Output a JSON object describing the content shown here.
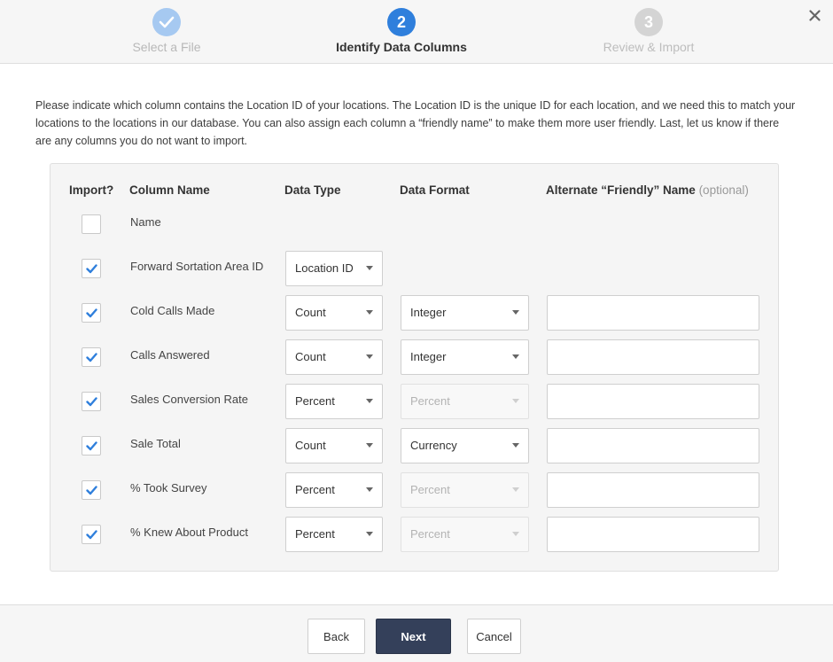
{
  "stepper": {
    "steps": [
      {
        "number": "1",
        "label": "Select a File",
        "state": "done"
      },
      {
        "number": "2",
        "label": "Identify Data Columns",
        "state": "active"
      },
      {
        "number": "3",
        "label": "Review & Import",
        "state": "todo"
      }
    ]
  },
  "description": "Please indicate which column contains the Location ID of your locations. The Location ID is the unique ID for each location, and we need this to match your locations to the locations in our database. You can also assign each column a “friendly name” to make them more user friendly. Last, let us know if there are any columns you do not want to import.",
  "table": {
    "headers": {
      "import": "Import?",
      "column_name": "Column Name",
      "data_type": "Data Type",
      "data_format": "Data Format",
      "friendly_name": "Alternate “Friendly” Name",
      "friendly_optional": "(optional)"
    },
    "rows": [
      {
        "name": "Name",
        "checked": false,
        "data_type": null,
        "data_format": null,
        "format_disabled": false,
        "friendly": null
      },
      {
        "name": "Forward Sortation Area ID",
        "checked": true,
        "data_type": "Location ID",
        "data_format": null,
        "format_disabled": false,
        "friendly": null
      },
      {
        "name": "Cold Calls Made",
        "checked": true,
        "data_type": "Count",
        "data_format": "Integer",
        "format_disabled": false,
        "friendly": ""
      },
      {
        "name": "Calls Answered",
        "checked": true,
        "data_type": "Count",
        "data_format": "Integer",
        "format_disabled": false,
        "friendly": ""
      },
      {
        "name": "Sales Conversion Rate",
        "checked": true,
        "data_type": "Percent",
        "data_format": "Percent",
        "format_disabled": true,
        "friendly": ""
      },
      {
        "name": "Sale Total",
        "checked": true,
        "data_type": "Count",
        "data_format": "Currency",
        "format_disabled": false,
        "friendly": ""
      },
      {
        "name": "% Took Survey",
        "checked": true,
        "data_type": "Percent",
        "data_format": "Percent",
        "format_disabled": true,
        "friendly": ""
      },
      {
        "name": "% Knew About Product",
        "checked": true,
        "data_type": "Percent",
        "data_format": "Percent",
        "format_disabled": true,
        "friendly": ""
      }
    ]
  },
  "footer": {
    "back": "Back",
    "next": "Next",
    "cancel": "Cancel"
  },
  "icons": {
    "close": "close-icon",
    "check": "check-icon",
    "caret": "caret-down-icon"
  },
  "colors": {
    "accent": "#2f7fdc",
    "step_done": "#a6c9f1",
    "primary_button": "#34405a",
    "checkmark": "#2f7fdc"
  }
}
